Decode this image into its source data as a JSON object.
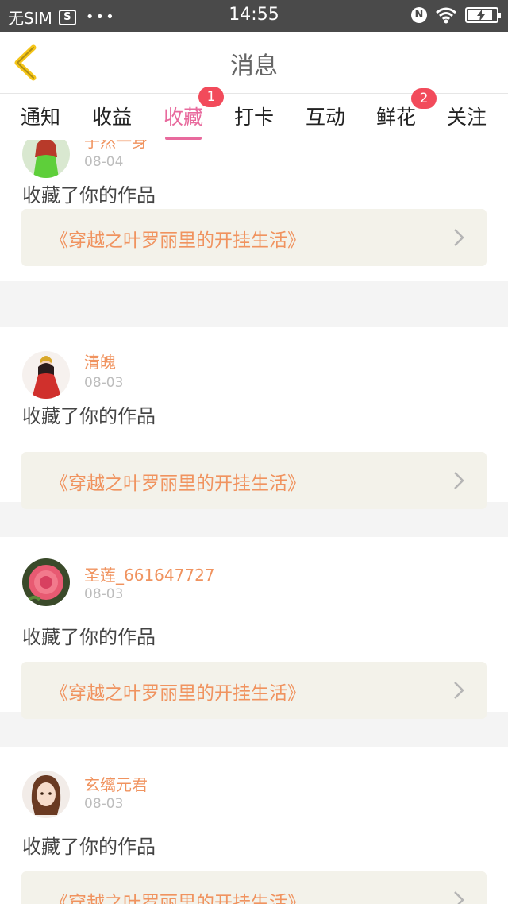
{
  "status_bar": {
    "carrier": "无SIM",
    "sim_icon_text": "S",
    "more_dots": "•••",
    "time": "14:55",
    "nfc_letter": "N",
    "icons": [
      "sim-card-icon",
      "more-dots-icon",
      "nfc-icon",
      "wifi-icon",
      "battery-charging-icon"
    ]
  },
  "header": {
    "title": "消息",
    "back_icon": "chevron-left-icon",
    "accent": "#f5c518"
  },
  "tabs": [
    {
      "label": "通知",
      "badge": ""
    },
    {
      "label": "收益",
      "badge": ""
    },
    {
      "label": "收藏",
      "badge": "1",
      "active": true
    },
    {
      "label": "打卡",
      "badge": ""
    },
    {
      "label": "互动",
      "badge": ""
    },
    {
      "label": "鲜花",
      "badge": "2"
    },
    {
      "label": "关注",
      "badge": ""
    }
  ],
  "colors": {
    "active_tab": "#e86a9d",
    "badge": "#f24b5b",
    "name": "#f0935f",
    "work_box": "#f3f2ea"
  },
  "messages": [
    {
      "name": "子然一身",
      "date": "08-04",
      "action": "收藏了你的作品",
      "work": "《穿越之叶罗丽里的开挂生活》",
      "avatar_icon": "avatar-girl-green-icon"
    },
    {
      "name": "清魄",
      "date": "08-03",
      "action": "收藏了你的作品",
      "work": "《穿越之叶罗丽里的开挂生活》",
      "avatar_icon": "avatar-red-dress-icon"
    },
    {
      "name": "圣莲_661647727",
      "date": "08-03",
      "action": "收藏了你的作品",
      "work": "《穿越之叶罗丽里的开挂生活》",
      "avatar_icon": "avatar-rose-icon"
    },
    {
      "name": "玄缡元君",
      "date": "08-03",
      "action": "收藏了你的作品",
      "work": "《穿越之叶罗丽里的开挂生活》",
      "avatar_icon": "avatar-brown-hair-icon"
    }
  ]
}
